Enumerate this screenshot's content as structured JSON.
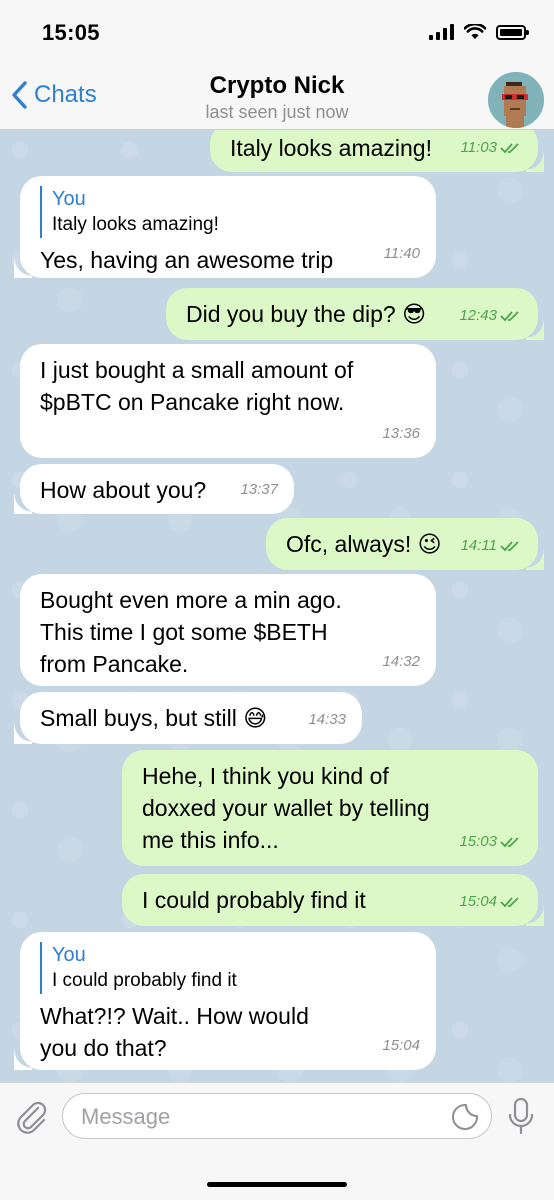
{
  "status": {
    "time": "15:05"
  },
  "header": {
    "back_label": "Chats",
    "title": "Crypto Nick",
    "subtitle": "last seen just now"
  },
  "messages": [
    {
      "dir": "out",
      "text": "Italy looks amazing!",
      "time": "11:03"
    },
    {
      "dir": "in",
      "reply_name": "You",
      "reply_text": "Italy looks amazing!",
      "text": "Yes, having an awesome trip",
      "time": "11:40"
    },
    {
      "dir": "out",
      "text": "Did you buy the dip? 😎",
      "time": "12:43"
    },
    {
      "dir": "in",
      "text": "I just bought a small amount of $pBTC on Pancake right now.",
      "time": "13:36"
    },
    {
      "dir": "in",
      "text": "How about you?",
      "time": "13:37"
    },
    {
      "dir": "out",
      "text": "Ofc, always! 😉",
      "time": "14:11"
    },
    {
      "dir": "in",
      "text": "Bought even more a min ago. This time I got some $BETH from Pancake.",
      "time": "14:32"
    },
    {
      "dir": "in",
      "text": "Small buys, but still 😅",
      "time": "14:33"
    },
    {
      "dir": "out",
      "text": "Hehe, I think you kind of doxxed your wallet by telling me this info...",
      "time": "15:03"
    },
    {
      "dir": "out",
      "text": "I could probably find it",
      "time": "15:04"
    },
    {
      "dir": "in",
      "reply_name": "You",
      "reply_text": "I could probably find it",
      "text": "What?!? Wait.. How would you do that?",
      "time": "15:04"
    }
  ],
  "composer": {
    "placeholder": "Message"
  },
  "colors": {
    "accent": "#2f7fd0",
    "outgoing": "#dcf8c6",
    "incoming": "#ffffff",
    "wallpaper": "#c4d5e3",
    "read_check": "#4ca54c"
  }
}
